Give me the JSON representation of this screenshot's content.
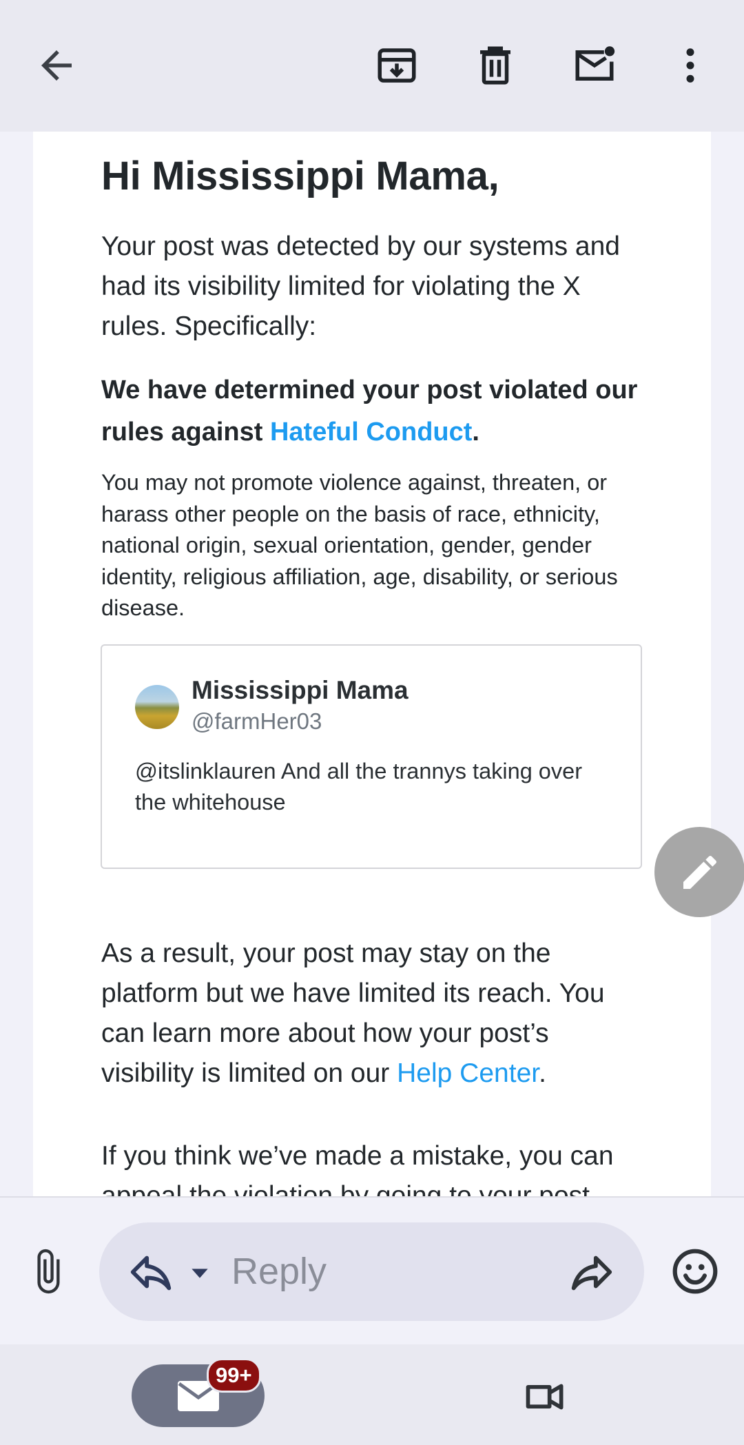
{
  "toolbar": {
    "back": "back-arrow",
    "archive": "archive",
    "delete": "delete",
    "mark_unread": "mark-unread",
    "more": "more-options"
  },
  "email": {
    "greeting": "Hi Mississippi Mama,",
    "intro": "Your post was detected by our systems and had its visibility limited for violating the X rules. Specifically:",
    "determined_prefix": "We have determined your post violated our rules against ",
    "rule_link": "Hateful Conduct",
    "determined_suffix": ".",
    "policy": "You may not promote violence against, threaten, or harass other people on the basis of race, ethnicity, national origin, sexual orientation, gender, gender identity, religious affiliation, age, disability, or serious disease.",
    "tweet": {
      "name": "Mississippi Mama",
      "handle": "@farmHer03",
      "text": "@itslinklauren And all the trannys taking over the whitehouse"
    },
    "result_prefix": "As a result, your post may stay on the platform but we have limited its reach. You can learn more about how your post’s visibility is limited on our ",
    "help_link": "Help Center",
    "result_suffix": ".",
    "appeal": "If you think we’ve made a mistake, you can appeal the violation by going to your post"
  },
  "reply_bar": {
    "placeholder": "Reply"
  },
  "bottom_nav": {
    "mail_badge": "99+"
  },
  "colors": {
    "link": "#1d9bf0",
    "badge": "#8b0f0f",
    "mail_pill": "#6e7386"
  }
}
